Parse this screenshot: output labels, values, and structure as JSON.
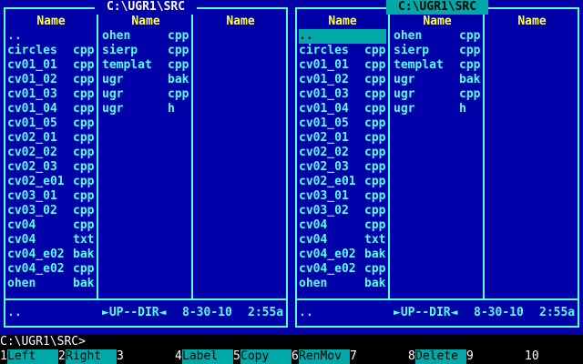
{
  "left_panel": {
    "path": "C:\\UGR1\\SRC",
    "active": false,
    "columns": [
      "Name",
      "Name",
      "Name"
    ],
    "col1": [
      {
        "name": "..",
        "ext": ""
      },
      {
        "name": "circles",
        "ext": "cpp"
      },
      {
        "name": "cv01_01",
        "ext": "cpp"
      },
      {
        "name": "cv01_02",
        "ext": "cpp"
      },
      {
        "name": "cv01_03",
        "ext": "cpp"
      },
      {
        "name": "cv01_04",
        "ext": "cpp"
      },
      {
        "name": "cv01_05",
        "ext": "cpp"
      },
      {
        "name": "cv02_01",
        "ext": "cpp"
      },
      {
        "name": "cv02_02",
        "ext": "cpp"
      },
      {
        "name": "cv02_03",
        "ext": "cpp"
      },
      {
        "name": "cv02_e01",
        "ext": "cpp"
      },
      {
        "name": "cv03_01",
        "ext": "cpp"
      },
      {
        "name": "cv03_02",
        "ext": "cpp"
      },
      {
        "name": "cv04",
        "ext": "cpp"
      },
      {
        "name": "cv04",
        "ext": "txt"
      },
      {
        "name": "cv04_e02",
        "ext": "bak"
      },
      {
        "name": "cv04_e02",
        "ext": "cpp"
      },
      {
        "name": "ohen",
        "ext": "bak"
      }
    ],
    "col2": [
      {
        "name": "ohen",
        "ext": "cpp"
      },
      {
        "name": "sierp",
        "ext": "cpp"
      },
      {
        "name": "templat",
        "ext": "cpp"
      },
      {
        "name": "ugr",
        "ext": "bak"
      },
      {
        "name": "ugr",
        "ext": "cpp"
      },
      {
        "name": "ugr",
        "ext": "h"
      }
    ],
    "status": {
      "name": "..",
      "dir": "►UP--DIR◄",
      "date": "8-30-10",
      "time": "2:55a"
    }
  },
  "right_panel": {
    "path": "C:\\UGR1\\SRC",
    "active": true,
    "columns": [
      "Name",
      "Name",
      "Name"
    ],
    "col1": [
      {
        "name": "..",
        "ext": ""
      },
      {
        "name": "circles",
        "ext": "cpp"
      },
      {
        "name": "cv01_01",
        "ext": "cpp"
      },
      {
        "name": "cv01_02",
        "ext": "cpp"
      },
      {
        "name": "cv01_03",
        "ext": "cpp"
      },
      {
        "name": "cv01_04",
        "ext": "cpp"
      },
      {
        "name": "cv01_05",
        "ext": "cpp"
      },
      {
        "name": "cv02_01",
        "ext": "cpp"
      },
      {
        "name": "cv02_02",
        "ext": "cpp"
      },
      {
        "name": "cv02_03",
        "ext": "cpp"
      },
      {
        "name": "cv02_e01",
        "ext": "cpp"
      },
      {
        "name": "cv03_01",
        "ext": "cpp"
      },
      {
        "name": "cv03_02",
        "ext": "cpp"
      },
      {
        "name": "cv04",
        "ext": "cpp"
      },
      {
        "name": "cv04",
        "ext": "txt"
      },
      {
        "name": "cv04_e02",
        "ext": "bak"
      },
      {
        "name": "cv04_e02",
        "ext": "cpp"
      },
      {
        "name": "ohen",
        "ext": "bak"
      }
    ],
    "col2": [
      {
        "name": "ohen",
        "ext": "cpp"
      },
      {
        "name": "sierp",
        "ext": "cpp"
      },
      {
        "name": "templat",
        "ext": "cpp"
      },
      {
        "name": "ugr",
        "ext": "bak"
      },
      {
        "name": "ugr",
        "ext": "cpp"
      },
      {
        "name": "ugr",
        "ext": "h"
      }
    ],
    "status": {
      "name": "..",
      "dir": "►UP--DIR◄",
      "date": "8-30-10",
      "time": "2:55a"
    }
  },
  "command_line": "C:\\UGR1\\SRC>",
  "keybar": [
    {
      "num": "1",
      "label": "Left"
    },
    {
      "num": "2",
      "label": "Right"
    },
    {
      "num": "3",
      "label": ""
    },
    {
      "num": "4",
      "label": "Label"
    },
    {
      "num": "5",
      "label": "Copy"
    },
    {
      "num": "6",
      "label": "RenMov"
    },
    {
      "num": "7",
      "label": ""
    },
    {
      "num": "8",
      "label": "Delete"
    },
    {
      "num": "9",
      "label": ""
    },
    {
      "num": "10",
      "label": ""
    }
  ],
  "colors": {
    "panel_bg": "#0000a8",
    "frame": "#55ffff",
    "header_text": "#ffff55",
    "file_text": "#55ffff",
    "cursor_bg": "#00a8a8"
  }
}
